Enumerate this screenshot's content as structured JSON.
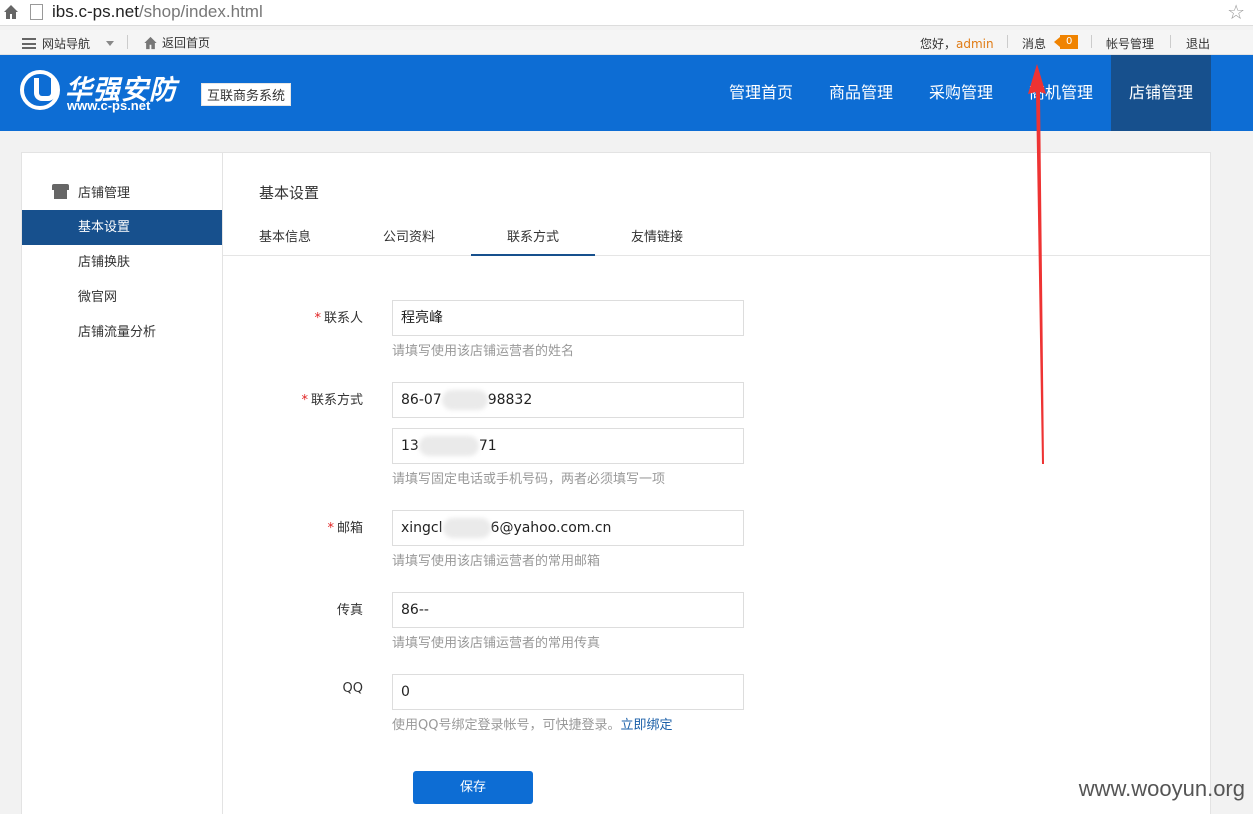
{
  "browser": {
    "url_host": "ibs.c-ps.net",
    "url_path": "/shop/index.html"
  },
  "topbar": {
    "site_nav": "网站导航",
    "back_home": "返回首页",
    "greeting": "您好，",
    "username": "admin",
    "messages": "消息",
    "message_count": "0",
    "account": "帐号管理",
    "logout": "退出"
  },
  "header": {
    "logo_cn": "华强安防",
    "logo_en": "www.c-ps.net",
    "system_tag": "互联商务系统",
    "nav": [
      {
        "label": "管理首页",
        "active": false
      },
      {
        "label": "商品管理",
        "active": false
      },
      {
        "label": "采购管理",
        "active": false
      },
      {
        "label": "商机管理",
        "active": false
      },
      {
        "label": "店铺管理",
        "active": true
      }
    ]
  },
  "sidebar": {
    "heading": "店铺管理",
    "items": [
      {
        "label": "基本设置",
        "active": true
      },
      {
        "label": "店铺换肤",
        "active": false
      },
      {
        "label": "微官网",
        "active": false
      },
      {
        "label": "店铺流量分析",
        "active": false
      }
    ]
  },
  "main": {
    "title": "基本设置",
    "tabs": [
      {
        "label": "基本信息",
        "active": false
      },
      {
        "label": "公司资料",
        "active": false
      },
      {
        "label": "联系方式",
        "active": true
      },
      {
        "label": "友情链接",
        "active": false
      }
    ]
  },
  "form": {
    "contact": {
      "label": "联系人",
      "required": true,
      "value": "程亮峰",
      "hint": "请填写使用该店铺运营者的姓名"
    },
    "phone": {
      "label": "联系方式",
      "required": true,
      "value_prefix": "86-07",
      "value_suffix": "98832",
      "mobile_prefix": "13",
      "mobile_suffix": "71",
      "hint": "请填写固定电话或手机号码，两者必须填写一项"
    },
    "email": {
      "label": "邮箱",
      "required": true,
      "value_prefix": "xingcl",
      "value_suffix": "6@yahoo.com.cn",
      "hint": "请填写使用该店铺运营者的常用邮箱"
    },
    "fax": {
      "label": "传真",
      "required": false,
      "value": "86--",
      "hint": "请填写使用该店铺运营者的常用传真"
    },
    "qq": {
      "label": "QQ",
      "required": false,
      "value": "0",
      "hint": "使用QQ号绑定登录帐号，可快捷登录。",
      "link": "立即绑定"
    },
    "save_label": "保存"
  },
  "watermark": "www.wooyun.org",
  "colors": {
    "brand_blue": "#0d6dd4",
    "active_nav": "#17508d",
    "badge": "#f08300",
    "arrow": "#ee3333"
  }
}
